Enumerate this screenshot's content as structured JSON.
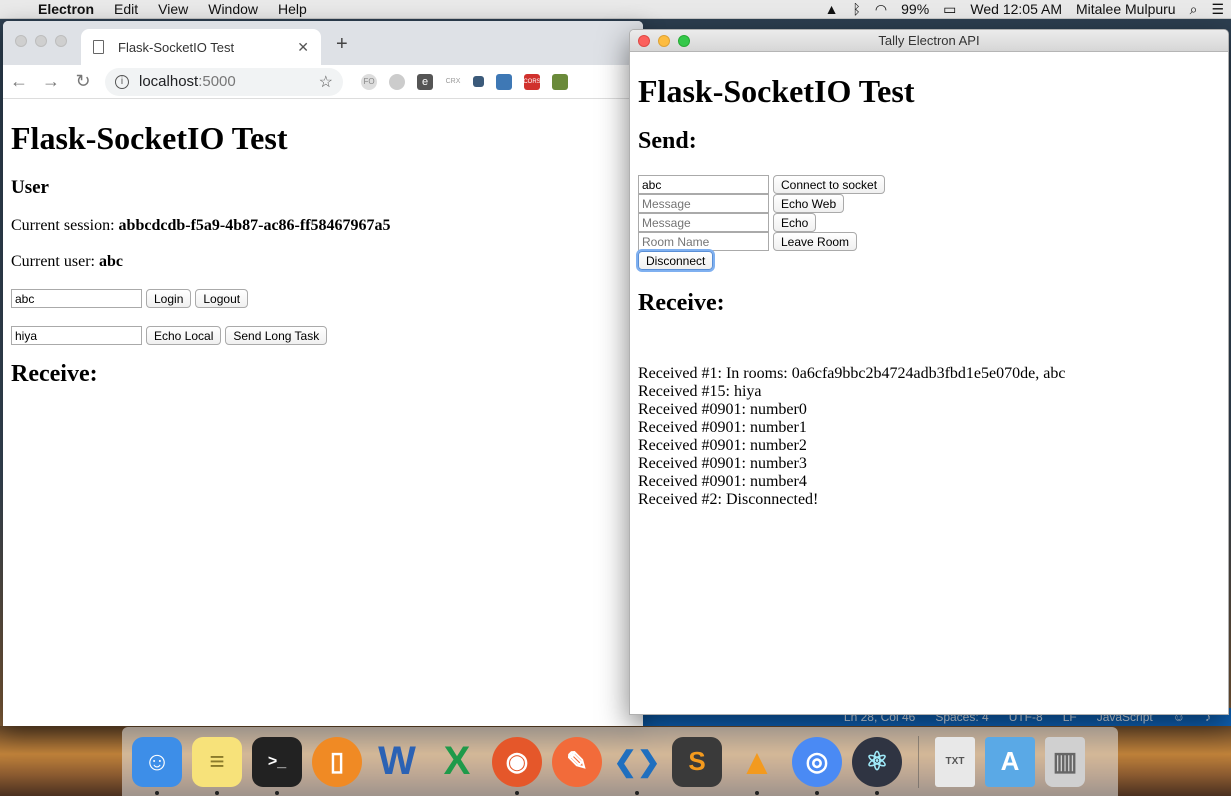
{
  "menubar": {
    "app_name": "Electron",
    "menus": [
      "Edit",
      "View",
      "Window",
      "Help"
    ],
    "battery": "99%",
    "clock": "Wed 12:05 AM",
    "user": "Mitalee Mulpuru"
  },
  "vscode_status": {
    "position": "Ln 28, Col 46",
    "spaces": "Spaces: 4",
    "encoding": "UTF-8",
    "eol": "LF",
    "language": "JavaScript"
  },
  "chrome": {
    "tab_title": "Flask-SocketIO Test",
    "url_host": "localhost",
    "url_port": ":5000",
    "extensions": [
      "FO",
      "",
      "e",
      "CRX",
      "",
      "",
      "CORS",
      ""
    ],
    "page": {
      "title": "Flask-SocketIO Test",
      "user_heading": "User",
      "session_label": "Current session: ",
      "session_value": "abbcdcdb-f5a9-4b87-ac86-ff58467967a5",
      "user_label": "Current user: ",
      "user_value": "abc",
      "login_input_value": "abc",
      "login_button": "Login",
      "logout_button": "Logout",
      "echo_input_value": "hiya",
      "echo_local_button": "Echo Local",
      "send_long_task_button": "Send Long Task",
      "receive_heading": "Receive:"
    }
  },
  "electron": {
    "window_title": "Tally Electron API",
    "page": {
      "title": "Flask-SocketIO Test",
      "send_heading": "Send:",
      "username_value": "abc",
      "connect_button": "Connect to socket",
      "message_placeholder_1": "Message",
      "echo_web_button": "Echo Web",
      "message_placeholder_2": "Message",
      "echo_button": "Echo",
      "room_placeholder": "Room Name",
      "leave_room_button": "Leave Room",
      "disconnect_button": "Disconnect",
      "receive_heading": "Receive:",
      "log": [
        "Received #1: In rooms: 0a6cfa9bbc2b4724adb3fbd1e5e070de, abc",
        "Received #15: hiya",
        "Received #0901: number0",
        "Received #0901: number1",
        "Received #0901: number2",
        "Received #0901: number3",
        "Received #0901: number4",
        "Received #2: Disconnected!"
      ]
    }
  },
  "dock": {
    "items": [
      {
        "icon": "finder-icon",
        "color": "#3d8ee8",
        "glyph": "☺"
      },
      {
        "icon": "notes-icon",
        "color": "#f7e27a",
        "glyph": "≡"
      },
      {
        "icon": "terminal-icon",
        "color": "#222222",
        "glyph": ">_"
      },
      {
        "icon": "ibooks-icon",
        "color": "#f08a24",
        "glyph": "▯"
      },
      {
        "icon": "word-icon",
        "color": "#2b62b4",
        "glyph": "W"
      },
      {
        "icon": "excel-icon",
        "color": "#1f9a4a",
        "glyph": "X"
      },
      {
        "icon": "firefox-icon",
        "color": "#e5572a",
        "glyph": "◉"
      },
      {
        "icon": "postman-icon",
        "color": "#f26b3a",
        "glyph": "✎"
      },
      {
        "icon": "vscode-icon",
        "color": "#1f6fbf",
        "glyph": "❮❯"
      },
      {
        "icon": "sublime-icon",
        "color": "#3a3a3a",
        "glyph": "S"
      },
      {
        "icon": "vlc-icon",
        "color": "#f39a1e",
        "glyph": "▲"
      },
      {
        "icon": "chrome-icon",
        "color": "#4a8af4",
        "glyph": "◎"
      },
      {
        "icon": "electron-icon",
        "color": "#2f3442",
        "glyph": "⚛"
      }
    ],
    "right_items": [
      {
        "icon": "text-file-icon",
        "color": "#e8e8e8",
        "glyph": "TXT"
      },
      {
        "icon": "applications-folder-icon",
        "color": "#5aa9e6",
        "glyph": "A"
      },
      {
        "icon": "trash-icon",
        "color": "#d0d0d0",
        "glyph": "🗑"
      }
    ]
  }
}
